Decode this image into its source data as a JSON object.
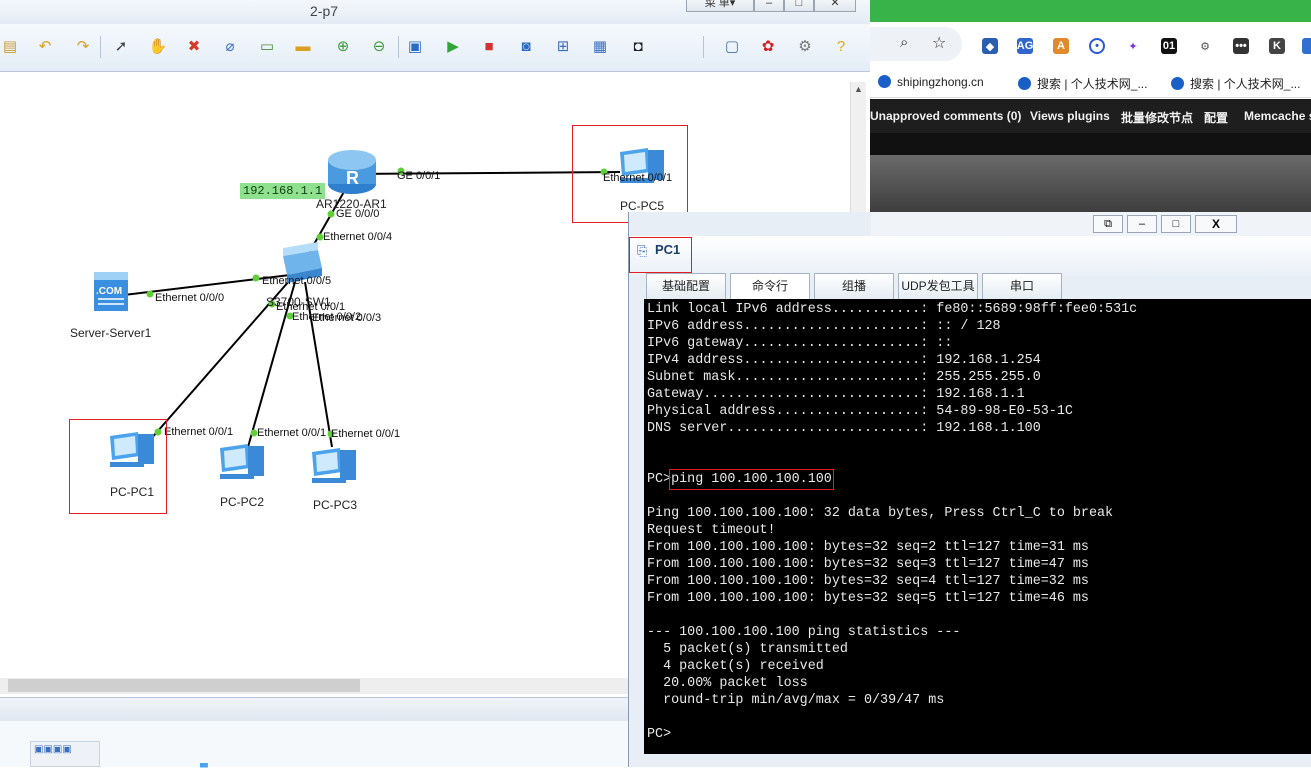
{
  "ensp": {
    "title": "2-p7",
    "menu_label": "菜 单▾",
    "win_min": "–",
    "win_max": "□",
    "win_close": "✕"
  },
  "topology": {
    "router_ip": "192.168.1.1",
    "router_name": "AR1220-AR1",
    "switch_name": "S3700-SW1",
    "server_name": "Server-Server1",
    "pc1_name": "PC-PC1",
    "pc2_name": "PC-PC2",
    "pc3_name": "PC-PC3",
    "pc5_name": "PC-PC5",
    "ports": {
      "r_ge001": "GE 0/0/1",
      "r_ge000": "GE 0/0/0",
      "pc5_eth": "Ethernet 0/0/1",
      "sw_e004": "Ethernet 0/0/4",
      "sw_e005": "Ethernet 0/0/5",
      "sw_e001": "Ethernet 0/0/1",
      "sw_e002": "Ethernet 0/0/2",
      "sw_e003": "Ethernet 0/0/3",
      "srv_eth": "Ethernet 0/0/0",
      "pc1_eth": "Ethernet 0/0/1",
      "pc2_eth": "Ethernet 0/0/1",
      "pc3_eth": "Ethernet 0/0/1"
    }
  },
  "browser": {
    "bookmarks": [
      "shipingzhong.cn",
      "搜索 | 个人技术网_...",
      "搜索 | 个人技术网_..."
    ],
    "wp_items": [
      "Unapproved comments (0)",
      "Views plugins",
      "批量修改节点",
      "配置",
      "Memcache s"
    ],
    "ext_labels": [
      "AG",
      "01",
      "K"
    ]
  },
  "pc1": {
    "title": "PC1",
    "tabs": [
      "基础配置",
      "命令行",
      "组播",
      "UDP发包工具",
      "串口"
    ],
    "active_tab": 1,
    "terminal_lines": [
      "Link local IPv6 address...........: fe80::5689:98ff:fee0:531c",
      "IPv6 address......................: :: / 128",
      "IPv6 gateway......................: ::",
      "IPv4 address......................: 192.168.1.254",
      "Subnet mask.......................: 255.255.255.0",
      "Gateway...........................: 192.168.1.1",
      "Physical address..................: 54-89-98-E0-53-1C",
      "DNS server........................: 192.168.1.100",
      "",
      "",
      "PC>ping 100.100.100.100",
      "",
      "Ping 100.100.100.100: 32 data bytes, Press Ctrl_C to break",
      "Request timeout!",
      "From 100.100.100.100: bytes=32 seq=2 ttl=127 time=31 ms",
      "From 100.100.100.100: bytes=32 seq=3 ttl=127 time=47 ms",
      "From 100.100.100.100: bytes=32 seq=4 ttl=127 time=32 ms",
      "From 100.100.100.100: bytes=32 seq=5 ttl=127 time=46 ms",
      "",
      "--- 100.100.100.100 ping statistics ---",
      "  5 packet(s) transmitted",
      "  4 packet(s) received",
      "  20.00% packet loss",
      "  round-trip min/avg/max = 0/39/47 ms",
      "",
      "PC>"
    ],
    "prompt": "PC>",
    "command": "ping 100.100.100.100",
    "win_close": "X"
  },
  "colors": {
    "link": "#000000",
    "port_dot": "#5fcf3a",
    "ip_tag": "#8fe08f",
    "selection": "#e02020",
    "browser_accent": "#37b34a"
  }
}
